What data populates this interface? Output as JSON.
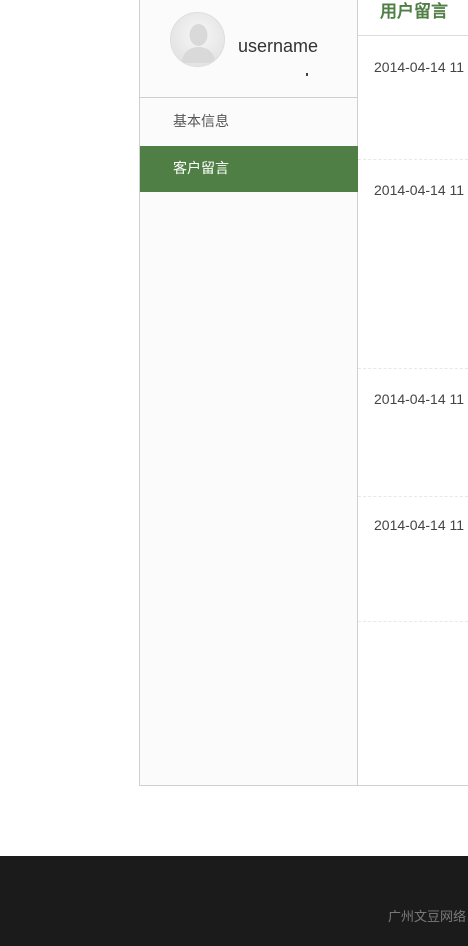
{
  "sidebar": {
    "username": "username",
    "items": [
      {
        "label": "基本信息"
      },
      {
        "label": "客户留言"
      }
    ]
  },
  "main": {
    "title": "用户留言",
    "messages": [
      {
        "date": "2014-04-14 11"
      },
      {
        "date": "2014-04-14 11"
      },
      {
        "date": "2014-04-14 11"
      },
      {
        "date": "2014-04-14 11"
      }
    ]
  },
  "footer": {
    "text": "广州文豆网络"
  },
  "colors": {
    "accent": "#4f7f45",
    "footer_bg": "#1b1b1b"
  },
  "icons": {
    "avatar": "user-silhouette-icon"
  }
}
